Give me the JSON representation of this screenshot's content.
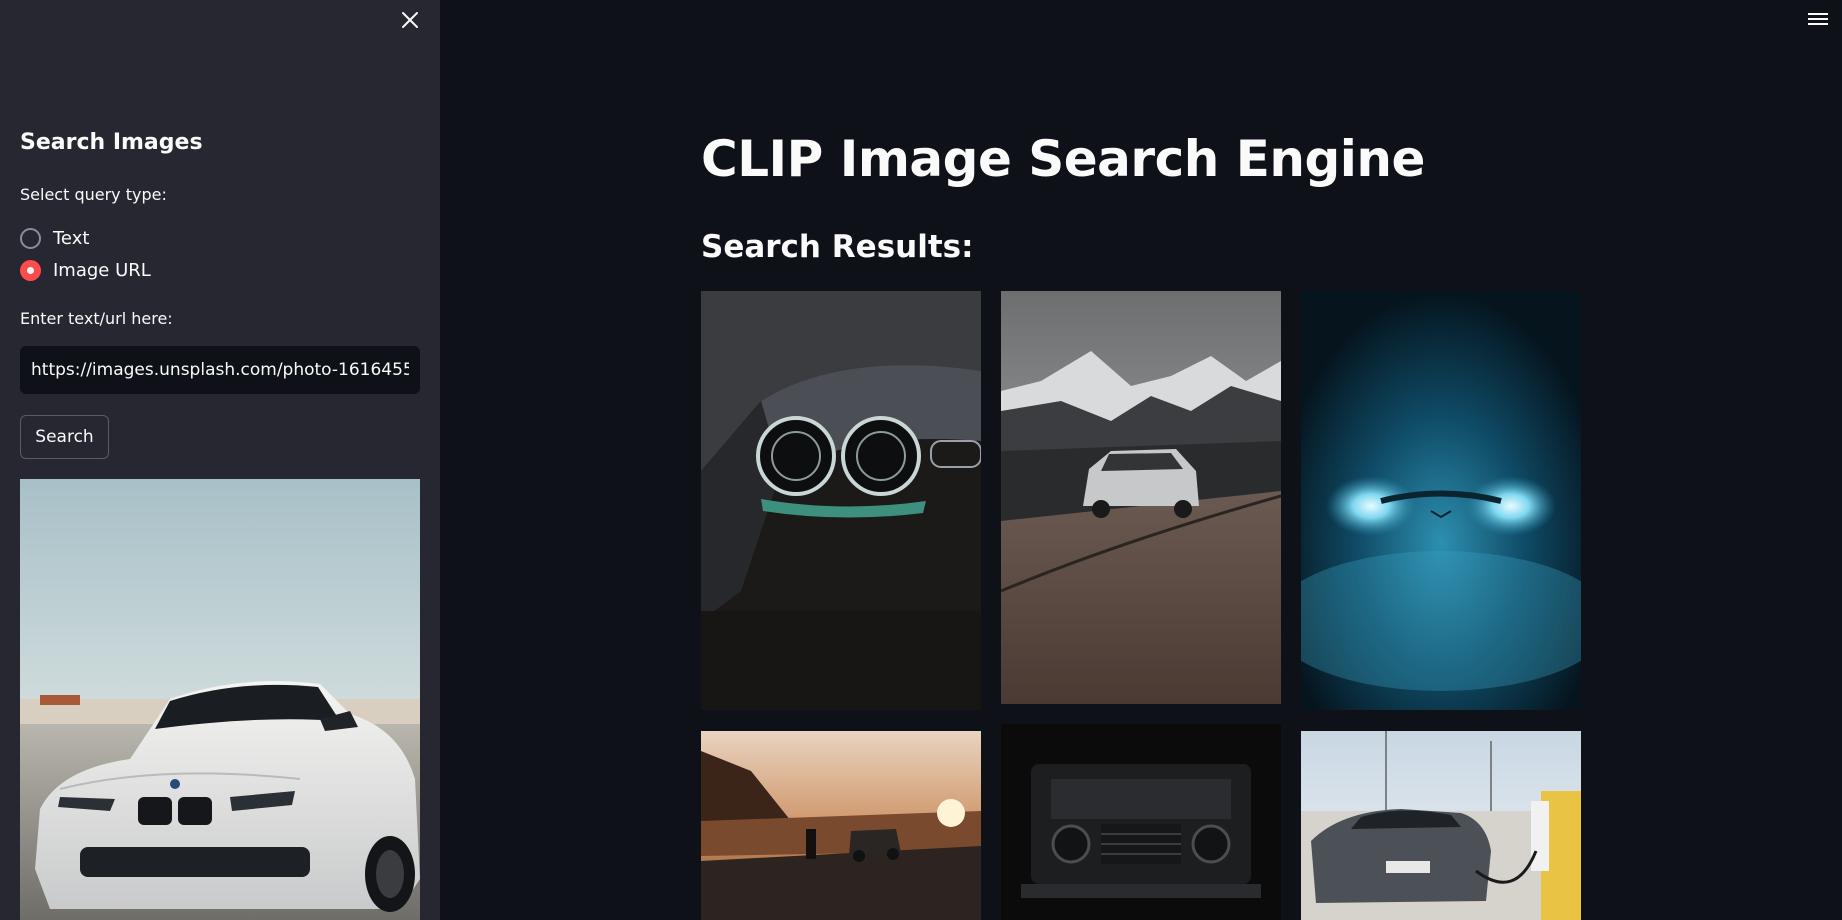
{
  "sidebar": {
    "title": "Search Images",
    "query_type_label": "Select query type:",
    "query_options": [
      {
        "label": "Text",
        "selected": false
      },
      {
        "label": "Image URL",
        "selected": true
      }
    ],
    "input_label": "Enter text/url here:",
    "input_value": "https://images.unsplash.com/photo-1616455",
    "search_label": "Search"
  },
  "main": {
    "title": "CLIP Image Search Engine",
    "results_heading": "Search Results:"
  },
  "icons": {
    "close": "close-icon",
    "menu": "hamburger-menu-icon"
  },
  "colors": {
    "background": "#0e1117",
    "sidebar": "#262730",
    "accent": "#ff4b4b",
    "text": "#fafafa"
  }
}
